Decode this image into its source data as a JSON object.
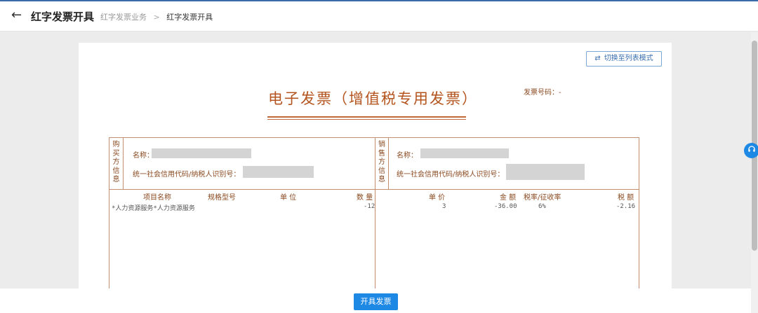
{
  "header": {
    "back_icon": "arrow-left-icon",
    "title": "红字发票开具",
    "breadcrumb": [
      "红字发票业务",
      "红字发票开具"
    ],
    "breadcrumb_sep": ">"
  },
  "switch_button": {
    "icon": "swap-icon",
    "icon_glyph": "⇄",
    "label": "切换至列表模式"
  },
  "invoice": {
    "title": "电子发票（增值税专用发票）",
    "number_label": "发票号码：",
    "number_value": "-",
    "buyer": {
      "section_label": [
        "购",
        "买",
        "方",
        "信",
        "息"
      ],
      "name_label": "名称：",
      "tax_id_label": "统一社会信用代码/纳税人识别号："
    },
    "seller": {
      "section_label": [
        "销",
        "售",
        "方",
        "信",
        "息"
      ],
      "name_label": "名称：",
      "tax_id_label": "统一社会信用代码/纳税人识别号："
    },
    "columns": [
      "项目名称",
      "规格型号",
      "单 位",
      "数 量",
      "单 价",
      "金 额",
      "税率/征收率",
      "税 额"
    ],
    "items": [
      {
        "name": "*人力资源服务*人力资源服务",
        "spec": "",
        "unit": "",
        "quantity": "-12",
        "unit_price": "3",
        "amount": "-36.00",
        "tax_rate": "6%",
        "tax": "-2.16"
      }
    ]
  },
  "help_button": {
    "icon": "headset-icon"
  },
  "footer": {
    "issue_button": "开具发票"
  },
  "colors": {
    "accent": "#1e88e5",
    "invoice_red": "#b4541e",
    "border": "#c48f70"
  }
}
